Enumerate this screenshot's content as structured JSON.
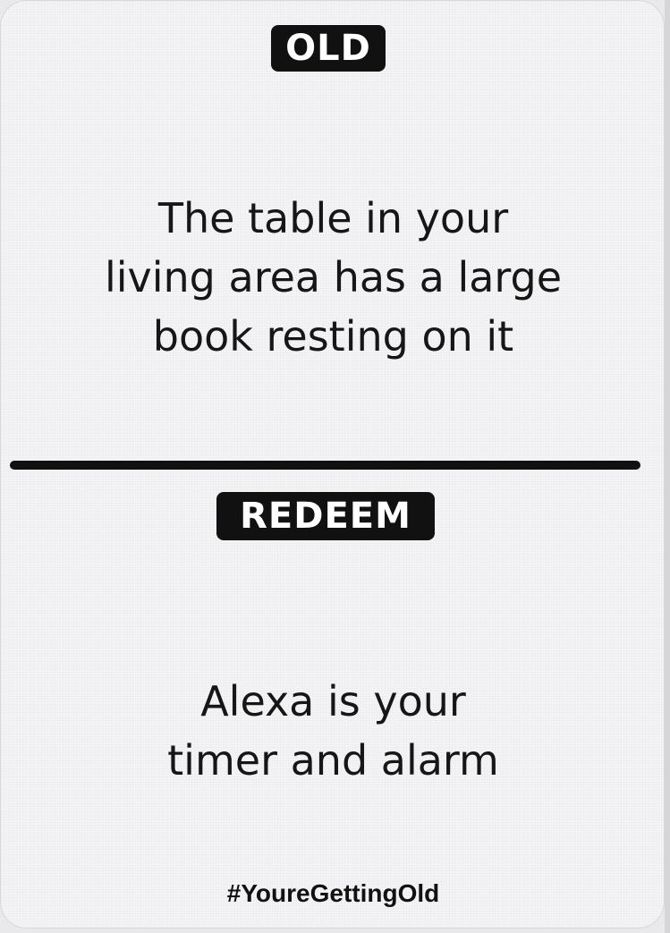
{
  "card": {
    "top_label": "OLD",
    "old_lines": [
      "The table in your",
      "living area has a large",
      "book resting on it"
    ],
    "bottom_label": "REDEEM",
    "redeem_lines": [
      "Alexa is your",
      "timer and alarm"
    ],
    "hashtag": "#YoureGettingOld"
  },
  "colors": {
    "card_background": "#f4f4f6",
    "ink": "#111111",
    "label_text": "#ffffff"
  }
}
